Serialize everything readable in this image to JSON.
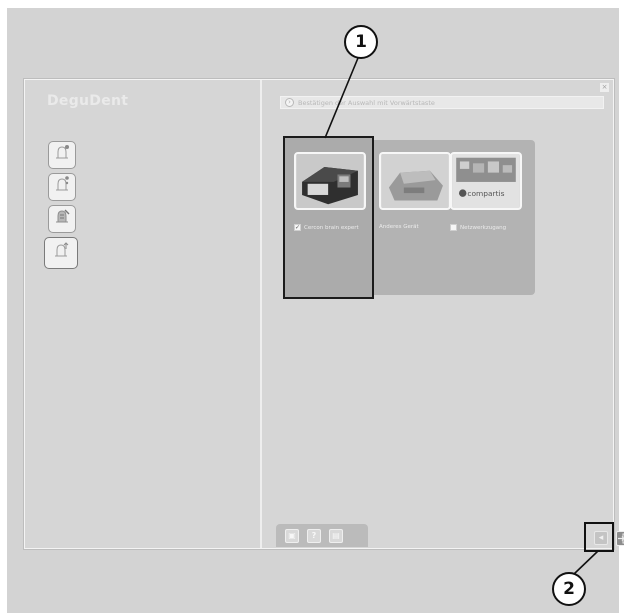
{
  "app": {
    "logo": "DeguDent"
  },
  "confirm_bar": {
    "icon": "arrow-circle-icon",
    "text": "Bestätigen der Auswahl mit Vorwärtstaste"
  },
  "window": {
    "close_glyph": "×"
  },
  "side_buttons": [
    {
      "icon": "bell-icon"
    },
    {
      "icon": "bell-icon"
    },
    {
      "icon": "bell-icon"
    },
    {
      "icon": "bell-icon"
    }
  ],
  "devices": [
    {
      "name": "Cercon brain expert",
      "checked": true
    },
    {
      "name": "Anderes Gerät",
      "checked": false
    },
    {
      "name": "Netzwerkzugang",
      "checked": false
    }
  ],
  "device_thumb_text": {
    "compartis": "compartis"
  },
  "check_glyph": "✓",
  "tray": [
    {
      "icon": "save-icon",
      "glyph": "▣"
    },
    {
      "icon": "help-icon",
      "glyph": "?"
    },
    {
      "icon": "document-icon",
      "glyph": "▤"
    }
  ],
  "nav": {
    "back_glyph": "◂"
  },
  "callouts": [
    "1",
    "2"
  ],
  "colors": {
    "background": "#d3d3d3",
    "highlight_border": "#1b1b1b",
    "device_panel": "#b3b3b3"
  }
}
